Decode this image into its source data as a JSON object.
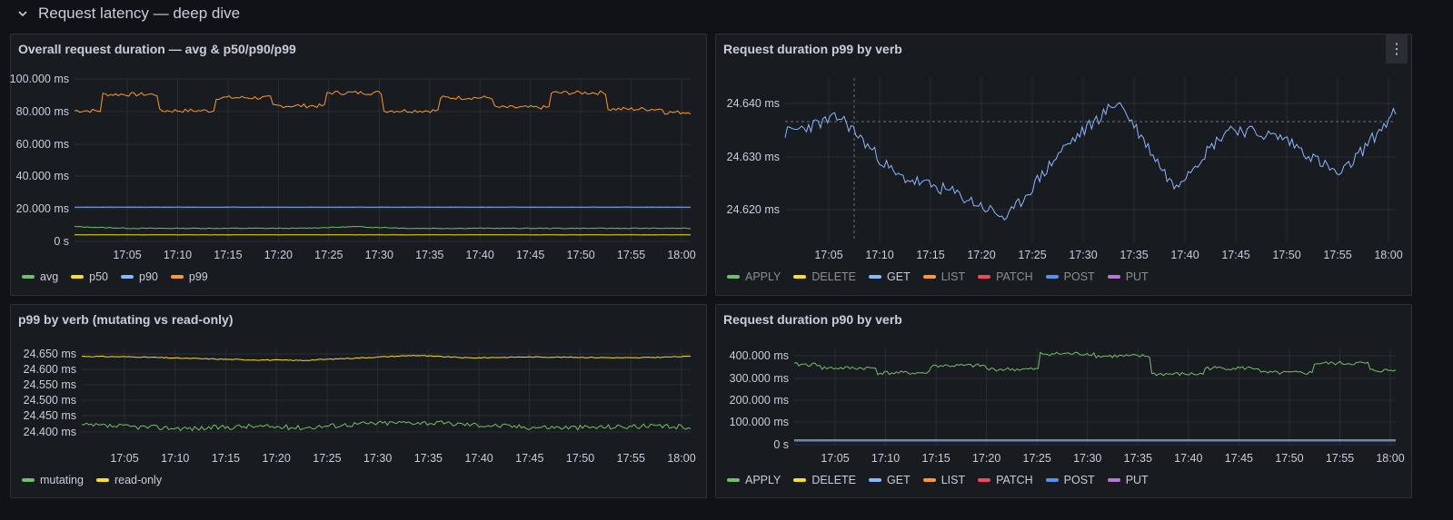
{
  "row": {
    "title": "Request latency — deep dive"
  },
  "x_ticks": [
    "17:05",
    "17:10",
    "17:15",
    "17:20",
    "17:25",
    "17:30",
    "17:35",
    "17:40",
    "17:45",
    "17:50",
    "17:55",
    "18:00"
  ],
  "panels": {
    "overall": {
      "title": "Overall request duration — avg & p50/p90/p99",
      "y_ticks": [
        "100.000 ms",
        "80.000 ms",
        "60.000 ms",
        "40.000 ms",
        "20.000 ms",
        "0 s"
      ],
      "legend": [
        {
          "name": "avg",
          "color": "#73bf69"
        },
        {
          "name": "p50",
          "color": "#fade2a"
        },
        {
          "name": "p90",
          "color": "#8ab8ff"
        },
        {
          "name": "p99",
          "color": "#ff9830"
        }
      ]
    },
    "p99verb": {
      "title": "Request duration p99 by verb",
      "menu_icon": "⋮",
      "y_ticks": [
        "24.640 ms",
        "24.630 ms",
        "24.620 ms"
      ],
      "legend": [
        {
          "name": "APPLY",
          "color": "#73bf69",
          "dim": true
        },
        {
          "name": "DELETE",
          "color": "#fade2a",
          "dim": true
        },
        {
          "name": "GET",
          "color": "#8ab8ff",
          "dim": false
        },
        {
          "name": "LIST",
          "color": "#ff9830",
          "dim": true
        },
        {
          "name": "PATCH",
          "color": "#f2495c",
          "dim": true
        },
        {
          "name": "POST",
          "color": "#5794f2",
          "dim": true
        },
        {
          "name": "PUT",
          "color": "#b877d9",
          "dim": true
        }
      ]
    },
    "mutating": {
      "title": "p99 by verb (mutating vs read-only)",
      "y_ticks": [
        "24.650 ms",
        "24.600 ms",
        "24.550 ms",
        "24.500 ms",
        "24.450 ms",
        "24.400 ms"
      ],
      "legend": [
        {
          "name": "mutating",
          "color": "#73bf69"
        },
        {
          "name": "read-only",
          "color": "#fade2a"
        }
      ]
    },
    "p90verb": {
      "title": "Request duration p90 by verb",
      "y_ticks": [
        "400.000 ms",
        "300.000 ms",
        "200.000 ms",
        "100.000 ms",
        "0 s"
      ],
      "legend": [
        {
          "name": "APPLY",
          "color": "#73bf69"
        },
        {
          "name": "DELETE",
          "color": "#fade2a"
        },
        {
          "name": "GET",
          "color": "#8ab8ff"
        },
        {
          "name": "LIST",
          "color": "#ff9830"
        },
        {
          "name": "PATCH",
          "color": "#f2495c"
        },
        {
          "name": "POST",
          "color": "#5794f2"
        },
        {
          "name": "PUT",
          "color": "#b877d9"
        }
      ]
    }
  },
  "chart_data": [
    {
      "type": "line",
      "title": "Overall request duration — avg & p50/p90/p99",
      "x": [
        "17:05",
        "17:10",
        "17:15",
        "17:20",
        "17:25",
        "17:30",
        "17:35",
        "17:40",
        "17:45",
        "17:50",
        "17:55",
        "18:00"
      ],
      "ylim": [
        0,
        100
      ],
      "series": [
        {
          "name": "p99",
          "values": [
            80,
            90,
            80,
            88,
            83,
            91,
            80,
            88,
            82,
            91,
            81,
            79
          ]
        },
        {
          "name": "p90",
          "values": [
            21,
            21,
            21,
            21,
            21,
            21,
            21,
            21,
            21,
            21,
            21,
            21
          ]
        },
        {
          "name": "avg",
          "values": [
            9,
            8,
            8,
            8,
            8,
            9,
            8,
            8,
            8,
            8,
            8,
            8
          ]
        },
        {
          "name": "p50",
          "values": [
            4,
            4,
            4,
            4,
            4,
            4,
            4,
            4,
            4,
            4,
            4,
            4
          ]
        }
      ]
    },
    {
      "type": "line",
      "title": "Request duration p99 by verb",
      "x": [
        "17:05",
        "17:10",
        "17:15",
        "17:20",
        "17:25",
        "17:30",
        "17:35",
        "17:40",
        "17:45",
        "17:50",
        "17:55",
        "18:00"
      ],
      "ylim": [
        24.615,
        24.643
      ],
      "series": [
        {
          "name": "GET",
          "values": [
            24.634,
            24.637,
            24.626,
            24.623,
            24.618,
            24.631,
            24.64,
            24.624,
            24.635,
            24.633,
            24.626,
            24.638
          ]
        }
      ]
    },
    {
      "type": "line",
      "title": "p99 by verb (mutating vs read-only)",
      "x": [
        "17:05",
        "17:10",
        "17:15",
        "17:20",
        "17:25",
        "17:30",
        "17:35",
        "17:40",
        "17:45",
        "17:50",
        "17:55",
        "18:00"
      ],
      "ylim": [
        24.38,
        24.66
      ],
      "series": [
        {
          "name": "read-only",
          "values": [
            24.635,
            24.633,
            24.628,
            24.624,
            24.622,
            24.63,
            24.638,
            24.63,
            24.633,
            24.632,
            24.63,
            24.635
          ]
        },
        {
          "name": "mutating",
          "values": [
            24.415,
            24.41,
            24.405,
            24.412,
            24.408,
            24.42,
            24.425,
            24.418,
            24.41,
            24.408,
            24.412,
            24.41
          ]
        }
      ]
    },
    {
      "type": "line",
      "title": "Request duration p90 by verb",
      "x": [
        "17:05",
        "17:10",
        "17:15",
        "17:20",
        "17:25",
        "17:30",
        "17:35",
        "17:40",
        "17:45",
        "17:50",
        "17:55",
        "18:00"
      ],
      "ylim": [
        0,
        410
      ],
      "series": [
        {
          "name": "APPLY",
          "values": [
            335,
            320,
            300,
            330,
            315,
            380,
            370,
            295,
            320,
            300,
            340,
            310
          ]
        },
        {
          "name": "GET",
          "values": [
            20,
            20,
            20,
            20,
            20,
            20,
            20,
            20,
            20,
            20,
            20,
            20
          ]
        },
        {
          "name": "LIST",
          "values": [
            18,
            18,
            18,
            18,
            18,
            18,
            18,
            18,
            18,
            18,
            18,
            18
          ]
        },
        {
          "name": "POST",
          "values": [
            15,
            15,
            15,
            15,
            15,
            15,
            15,
            15,
            15,
            15,
            15,
            15
          ]
        },
        {
          "name": "PATCH",
          "values": [
            17,
            17,
            17,
            17,
            17,
            17,
            17,
            17,
            17,
            17,
            17,
            17
          ]
        }
      ]
    }
  ]
}
